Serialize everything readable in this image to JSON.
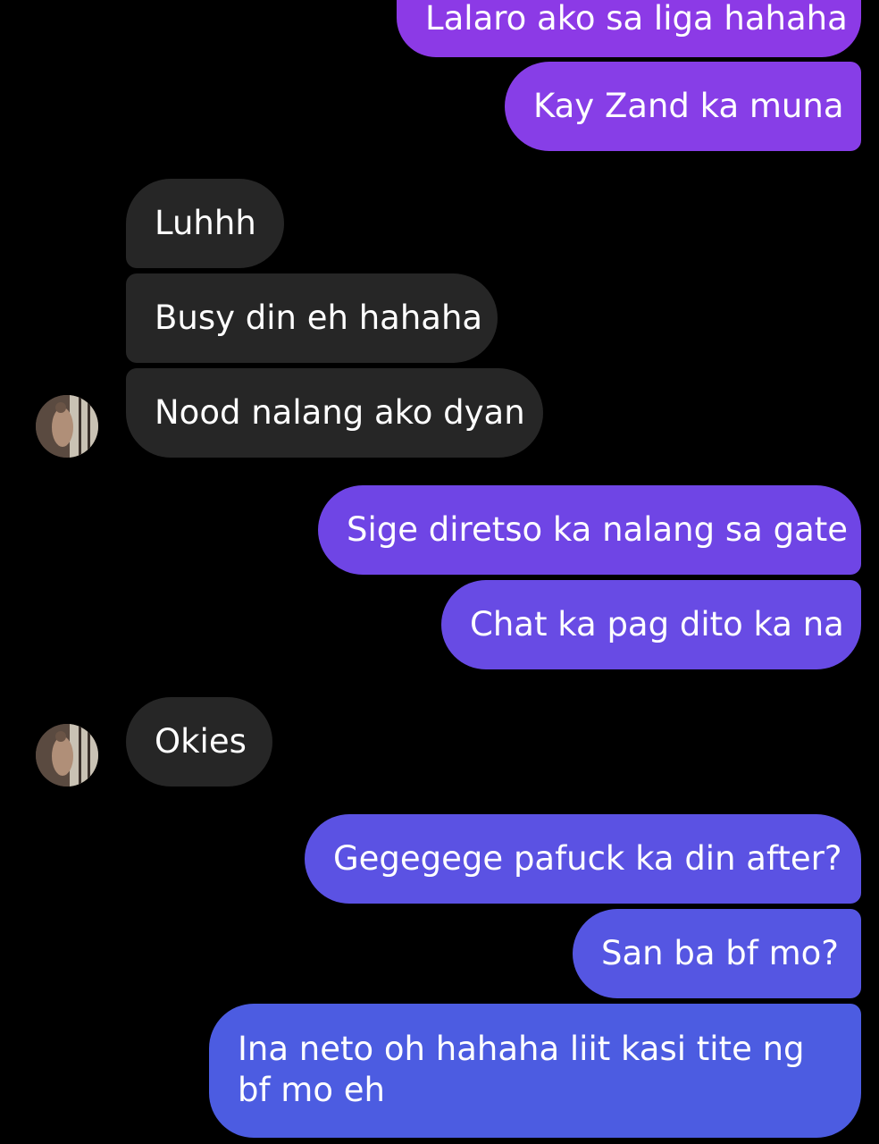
{
  "colors": {
    "background": "#000000",
    "received_bubble": "#262626",
    "sent_gradient_top": "#8a3ce6",
    "sent_gradient_bottom": "#4a5ee0",
    "text": "#ffffff"
  },
  "conversation": {
    "messages": [
      {
        "from": "me",
        "text": "Lalaro ako sa liga hahaha"
      },
      {
        "from": "me",
        "text": "Kay Zand ka muna"
      },
      {
        "from": "them",
        "text": "Luhhh"
      },
      {
        "from": "them",
        "text": "Busy din eh hahaha"
      },
      {
        "from": "them",
        "text": "Nood nalang ako dyan"
      },
      {
        "from": "me",
        "text": "Sige diretso ka nalang sa gate"
      },
      {
        "from": "me",
        "text": "Chat ka pag dito ka na"
      },
      {
        "from": "them",
        "text": "Okies"
      },
      {
        "from": "me",
        "text": "Gegegege pafuck ka din after?"
      },
      {
        "from": "me",
        "text": "San ba bf mo?"
      },
      {
        "from": "me",
        "text": "Ina neto oh hahaha liit kasi tite ng bf mo eh"
      }
    ]
  },
  "icons": {
    "avatar": "contact-avatar-icon"
  }
}
